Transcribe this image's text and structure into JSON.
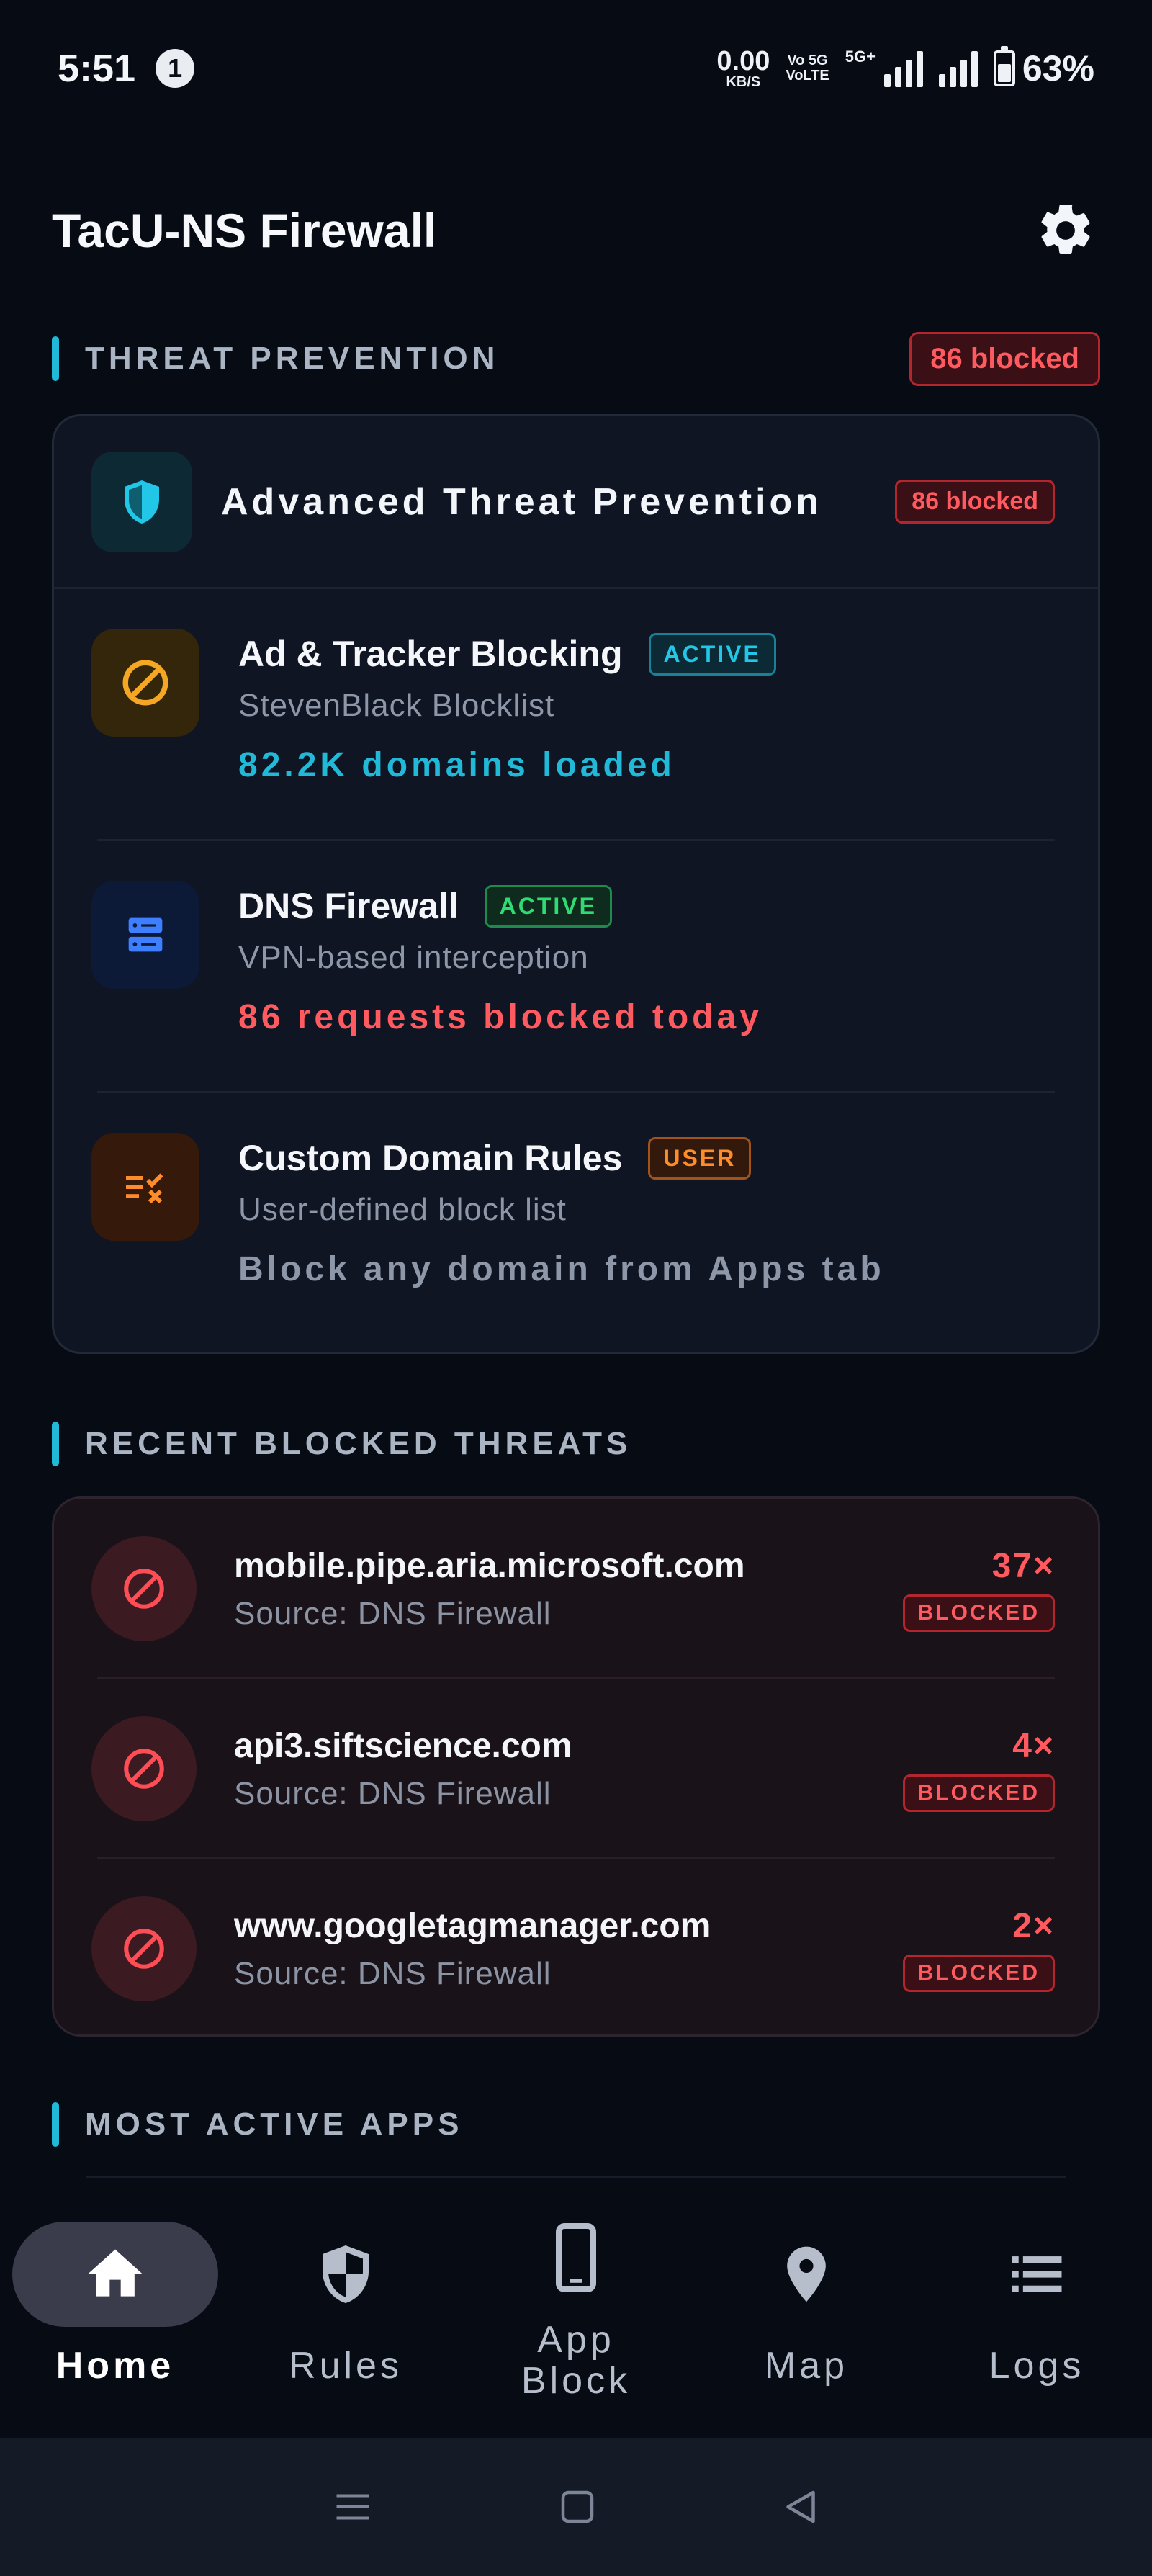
{
  "status_bar": {
    "time": "5:51",
    "notification_count": "1",
    "net_speed_value": "0.00",
    "net_speed_unit": "KB/S",
    "volte_label_1": "Vo 5G",
    "volte_label_2": "VoLTE",
    "network_type": "5G+",
    "battery_percent": "63%"
  },
  "header": {
    "title": "TacU-NS Firewall",
    "settings_icon": "gear-icon"
  },
  "threat_prevention": {
    "section_title": "THREAT PREVENTION",
    "section_badge": "86 blocked",
    "card_title": "Advanced Threat Prevention",
    "card_badge": "86 blocked",
    "features": [
      {
        "icon": "block-circle-icon",
        "title": "Ad & Tracker Blocking",
        "badge": "ACTIVE",
        "subtitle": "StevenBlack Blocklist",
        "stat": "82.2K domains loaded"
      },
      {
        "icon": "server-icon",
        "title": "DNS Firewall",
        "badge": "ACTIVE",
        "subtitle": "VPN-based interception",
        "stat": "86 requests blocked today"
      },
      {
        "icon": "rule-list-icon",
        "title": "Custom Domain Rules",
        "badge": "USER",
        "subtitle": "User-defined block list",
        "stat": "Block any domain from Apps tab"
      }
    ]
  },
  "recent_threats": {
    "section_title": "RECENT BLOCKED THREATS",
    "items": [
      {
        "domain": "mobile.pipe.aria.microsoft.com",
        "source": "Source: DNS Firewall",
        "count": "37×",
        "status": "BLOCKED"
      },
      {
        "domain": "api3.siftscience.com",
        "source": "Source: DNS Firewall",
        "count": "4×",
        "status": "BLOCKED"
      },
      {
        "domain": "www.googletagmanager.com",
        "source": "Source: DNS Firewall",
        "count": "2×",
        "status": "BLOCKED"
      }
    ]
  },
  "most_active": {
    "section_title": "MOST ACTIVE APPS"
  },
  "bottom_nav": {
    "items": [
      {
        "label": "Home",
        "icon": "home-icon",
        "active": true
      },
      {
        "label": "Rules",
        "icon": "shield-icon",
        "active": false
      },
      {
        "label": "App Block",
        "icon": "phone-icon",
        "active": false
      },
      {
        "label": "Map",
        "icon": "map-pin-icon",
        "active": false
      },
      {
        "label": "Logs",
        "icon": "list-icon",
        "active": false
      }
    ]
  },
  "colors": {
    "background": "#070b14",
    "accent_cyan": "#22b8d8",
    "danger_red": "#ff5a5f",
    "success_green": "#2fdc74",
    "warning_orange": "#ff8c2a"
  }
}
